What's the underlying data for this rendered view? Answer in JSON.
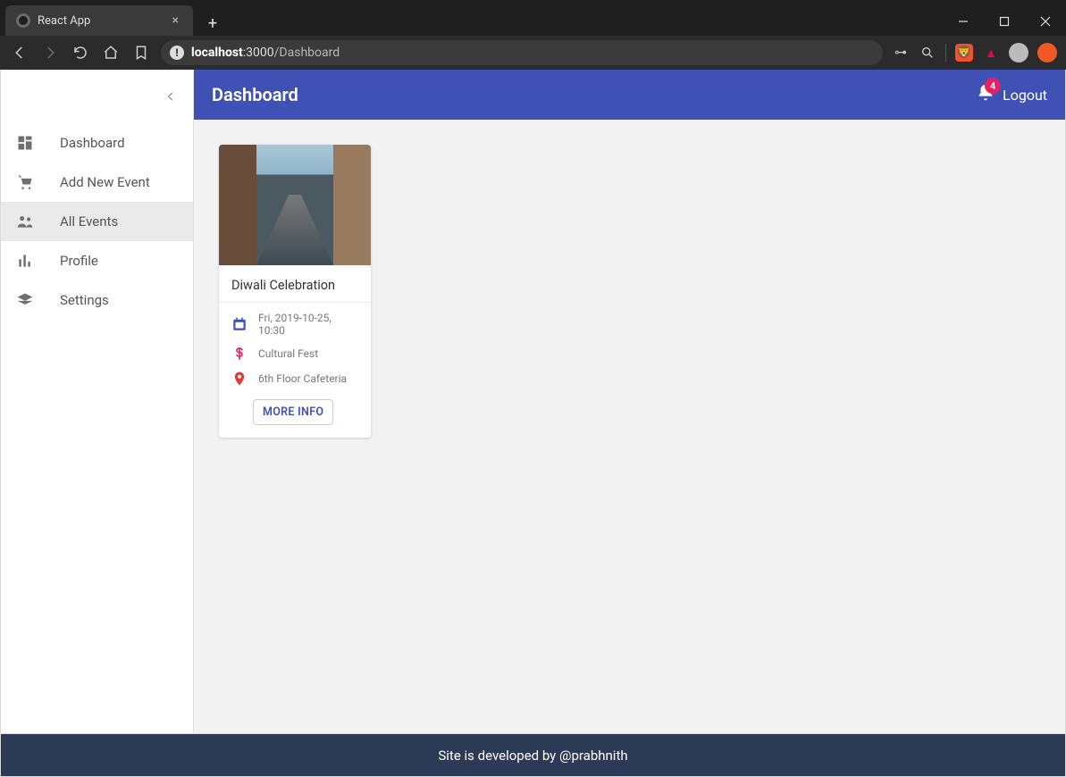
{
  "browser": {
    "tab_title": "React App",
    "url_host": "localhost",
    "url_port": ":3000",
    "url_path": "/Dashboard"
  },
  "sidebar": {
    "items": [
      {
        "label": "Dashboard",
        "icon": "dashboard-icon",
        "active": false
      },
      {
        "label": "Add New Event",
        "icon": "cart-icon",
        "active": false
      },
      {
        "label": "All Events",
        "icon": "people-icon",
        "active": true
      },
      {
        "label": "Profile",
        "icon": "barchart-icon",
        "active": false
      },
      {
        "label": "Settings",
        "icon": "layers-icon",
        "active": false
      }
    ]
  },
  "appbar": {
    "title": "Dashboard",
    "badge_count": "4",
    "logout_label": "Logout"
  },
  "event_card": {
    "title": "Diwali Celebration",
    "date": "Fri, 2019-10-25, 10:30",
    "category": "Cultural Fest",
    "location": "6th Floor Cafeteria",
    "more_label": "MORE INFO"
  },
  "footer": {
    "text": "Site is developed by @prabhnith"
  }
}
